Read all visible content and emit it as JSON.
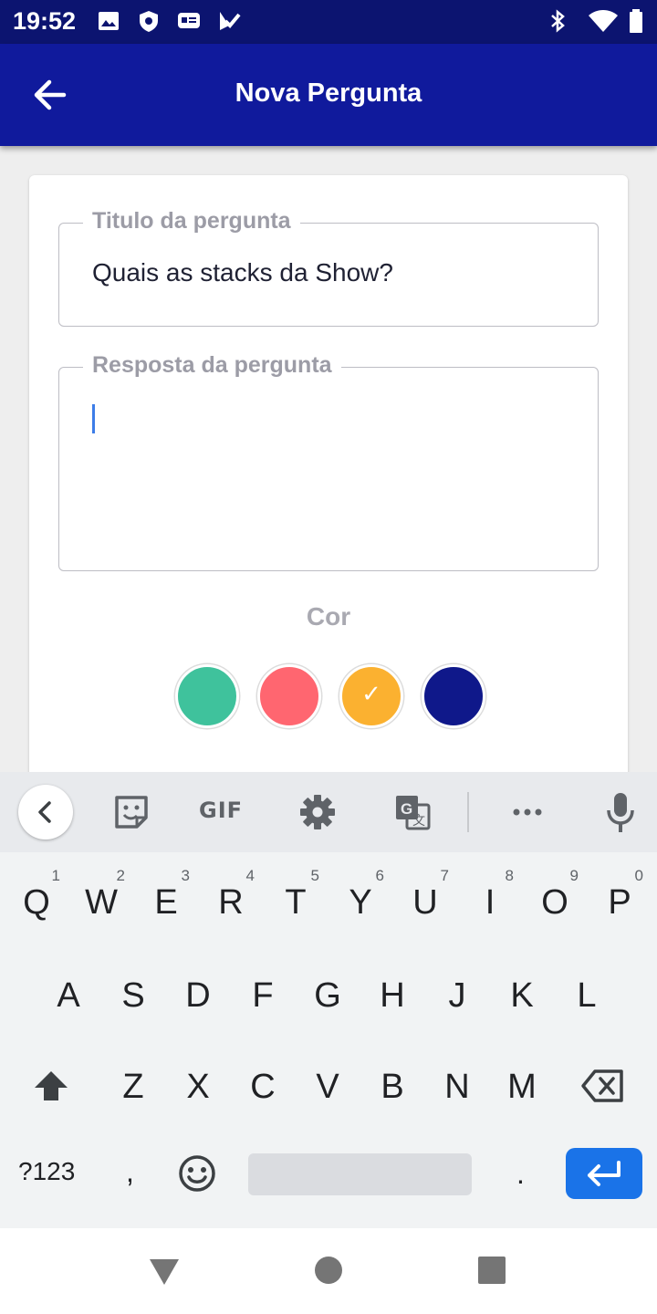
{
  "status_bar": {
    "time": "19:52",
    "icons": [
      "image-icon",
      "shield-icon",
      "message-icon",
      "check-icon",
      "bluetooth-icon",
      "wifi-icon",
      "battery-icon"
    ]
  },
  "app_bar": {
    "title": "Nova Pergunta",
    "back_icon": "arrow-back-icon"
  },
  "form": {
    "title_field": {
      "label": "Titulo da pergunta",
      "value": "Quais as stacks da Show?"
    },
    "answer_field": {
      "label": "Resposta da pergunta",
      "value": ""
    },
    "color_label": "Cor",
    "colors": [
      {
        "hex": "#3fc29c",
        "selected": false
      },
      {
        "hex": "#ff6670",
        "selected": false
      },
      {
        "hex": "#fbb130",
        "selected": true
      },
      {
        "hex": "#0f188a",
        "selected": false
      }
    ]
  },
  "keyboard": {
    "toolbar": {
      "gif_label": "GIF",
      "icons": [
        "chevron-left-icon",
        "sticker-icon",
        "settings-icon",
        "translate-icon",
        "more-icon",
        "mic-icon"
      ]
    },
    "row1": [
      {
        "key": "Q",
        "hint": "1"
      },
      {
        "key": "W",
        "hint": "2"
      },
      {
        "key": "E",
        "hint": "3"
      },
      {
        "key": "R",
        "hint": "4"
      },
      {
        "key": "T",
        "hint": "5"
      },
      {
        "key": "Y",
        "hint": "6"
      },
      {
        "key": "U",
        "hint": "7"
      },
      {
        "key": "I",
        "hint": "8"
      },
      {
        "key": "O",
        "hint": "9"
      },
      {
        "key": "P",
        "hint": "0"
      }
    ],
    "row2": [
      "A",
      "S",
      "D",
      "F",
      "G",
      "H",
      "J",
      "K",
      "L"
    ],
    "row3": [
      "Z",
      "X",
      "C",
      "V",
      "B",
      "N",
      "M"
    ],
    "symbols_label": "?123",
    "comma": ",",
    "period": "."
  },
  "colors": {
    "status_bar": "#0c1470",
    "app_bar": "#101a9c",
    "enter_key": "#1a73e8",
    "caret": "#3d7de8"
  }
}
